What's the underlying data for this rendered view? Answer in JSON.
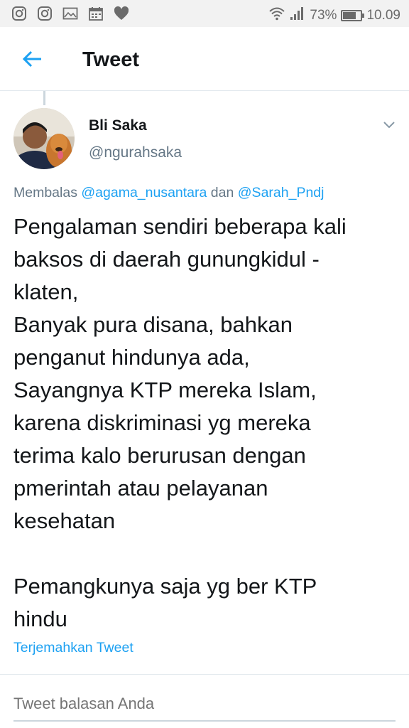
{
  "status_bar": {
    "left_icons": [
      "instagram-icon",
      "instagram-icon",
      "image-icon",
      "calendar-icon",
      "heart-icon"
    ],
    "battery_percent": "73%",
    "battery_level": 0.73,
    "time": "10.09"
  },
  "header": {
    "title": "Tweet"
  },
  "tweet": {
    "author_name": "Bli Saka",
    "author_handle": "@ngurahsaka",
    "reply_prefix": "Membalas",
    "reply_mention_1": "@agama_nusantara",
    "reply_joiner": "dan",
    "reply_mention_2": "@Sarah_Pndj",
    "text_lines": [
      "Pengalaman sendiri beberapa kali",
      "baksos di daerah gunungkidul -",
      "klaten,",
      "Banyak pura disana, bahkan",
      "penganut hindunya ada,",
      "Sayangnya KTP mereka Islam,",
      "karena diskriminasi yg mereka",
      "terima kalo berurusan dengan",
      "pmerintah atau pelayanan",
      "kesehatan",
      "",
      "Pemangkunya saja yg ber KTP",
      "hindu"
    ],
    "translate_label": "Terjemahkan Tweet"
  },
  "reply": {
    "placeholder": "Tweet balasan Anda"
  },
  "colors": {
    "accent": "#1da1f2",
    "text": "#14171a",
    "muted": "#657786",
    "status_bar_bg": "#f2f2f2"
  }
}
